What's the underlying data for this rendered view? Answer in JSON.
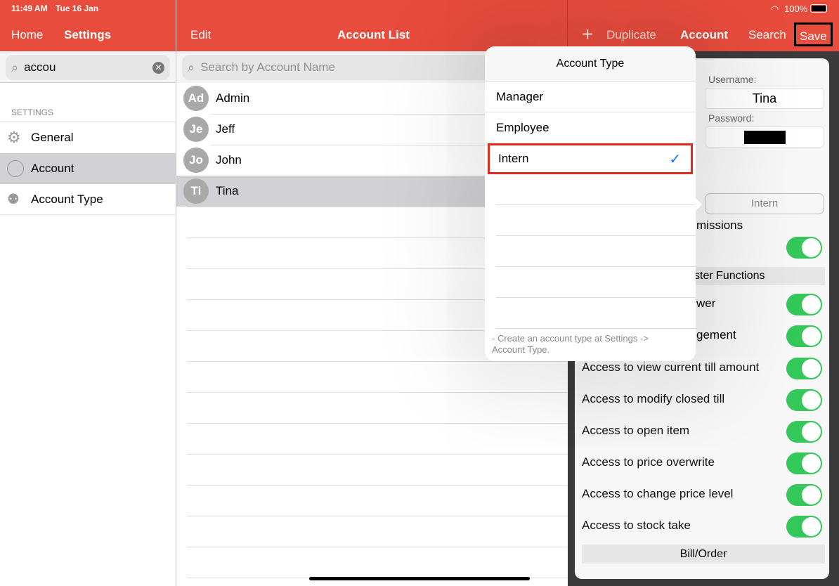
{
  "status_bar": {
    "time": "11:49 AM",
    "date": "Tue 16 Jan",
    "battery": "100%"
  },
  "left": {
    "nav": {
      "home": "Home",
      "title": "Settings"
    },
    "search": {
      "value": "accou"
    },
    "section": "SETTINGS",
    "items": [
      {
        "label": "General",
        "icon": "gear-icon"
      },
      {
        "label": "Account",
        "icon": "person-icon",
        "selected": true
      },
      {
        "label": "Account Type",
        "icon": "person-gear-icon"
      }
    ]
  },
  "middle": {
    "nav": {
      "edit": "Edit",
      "title": "Account List"
    },
    "search": {
      "placeholder": "Search by Account Name"
    },
    "accounts": [
      {
        "initials": "Ad",
        "name": "Admin"
      },
      {
        "initials": "Je",
        "name": "Jeff"
      },
      {
        "initials": "Jo",
        "name": "John"
      },
      {
        "initials": "Ti",
        "name": "Tina",
        "selected": true
      }
    ]
  },
  "right": {
    "nav": {
      "add": "+",
      "duplicate": "Duplicate",
      "title": "Account",
      "search": "Search",
      "save": "Save"
    },
    "username_label": "Username:",
    "username": "Tina",
    "password_label": "Password:",
    "account_type": "Intern",
    "partial": {
      "permissions": "missions",
      "master": "ster Functions",
      "row1": "wer",
      "row2": "gement"
    },
    "permissions": [
      {
        "label": "Access to view current till amount",
        "on": true
      },
      {
        "label": "Access to modify closed till",
        "on": true
      },
      {
        "label": "Access to open item",
        "on": true
      },
      {
        "label": "Access to price overwrite",
        "on": true
      },
      {
        "label": "Access to change price level",
        "on": true
      },
      {
        "label": "Access to stock take",
        "on": true
      }
    ],
    "section_bill": "Bill/Order"
  },
  "popover": {
    "title": "Account Type",
    "options": [
      {
        "label": "Manager"
      },
      {
        "label": "Employee"
      },
      {
        "label": "Intern",
        "selected": true
      }
    ],
    "footer": "- Create an account type at Settings -> Account Type."
  },
  "colors": {
    "accent": "#E84C3D",
    "toggle_on": "#34C759",
    "check": "#1a73e8",
    "highlight": "#e02a1c"
  }
}
